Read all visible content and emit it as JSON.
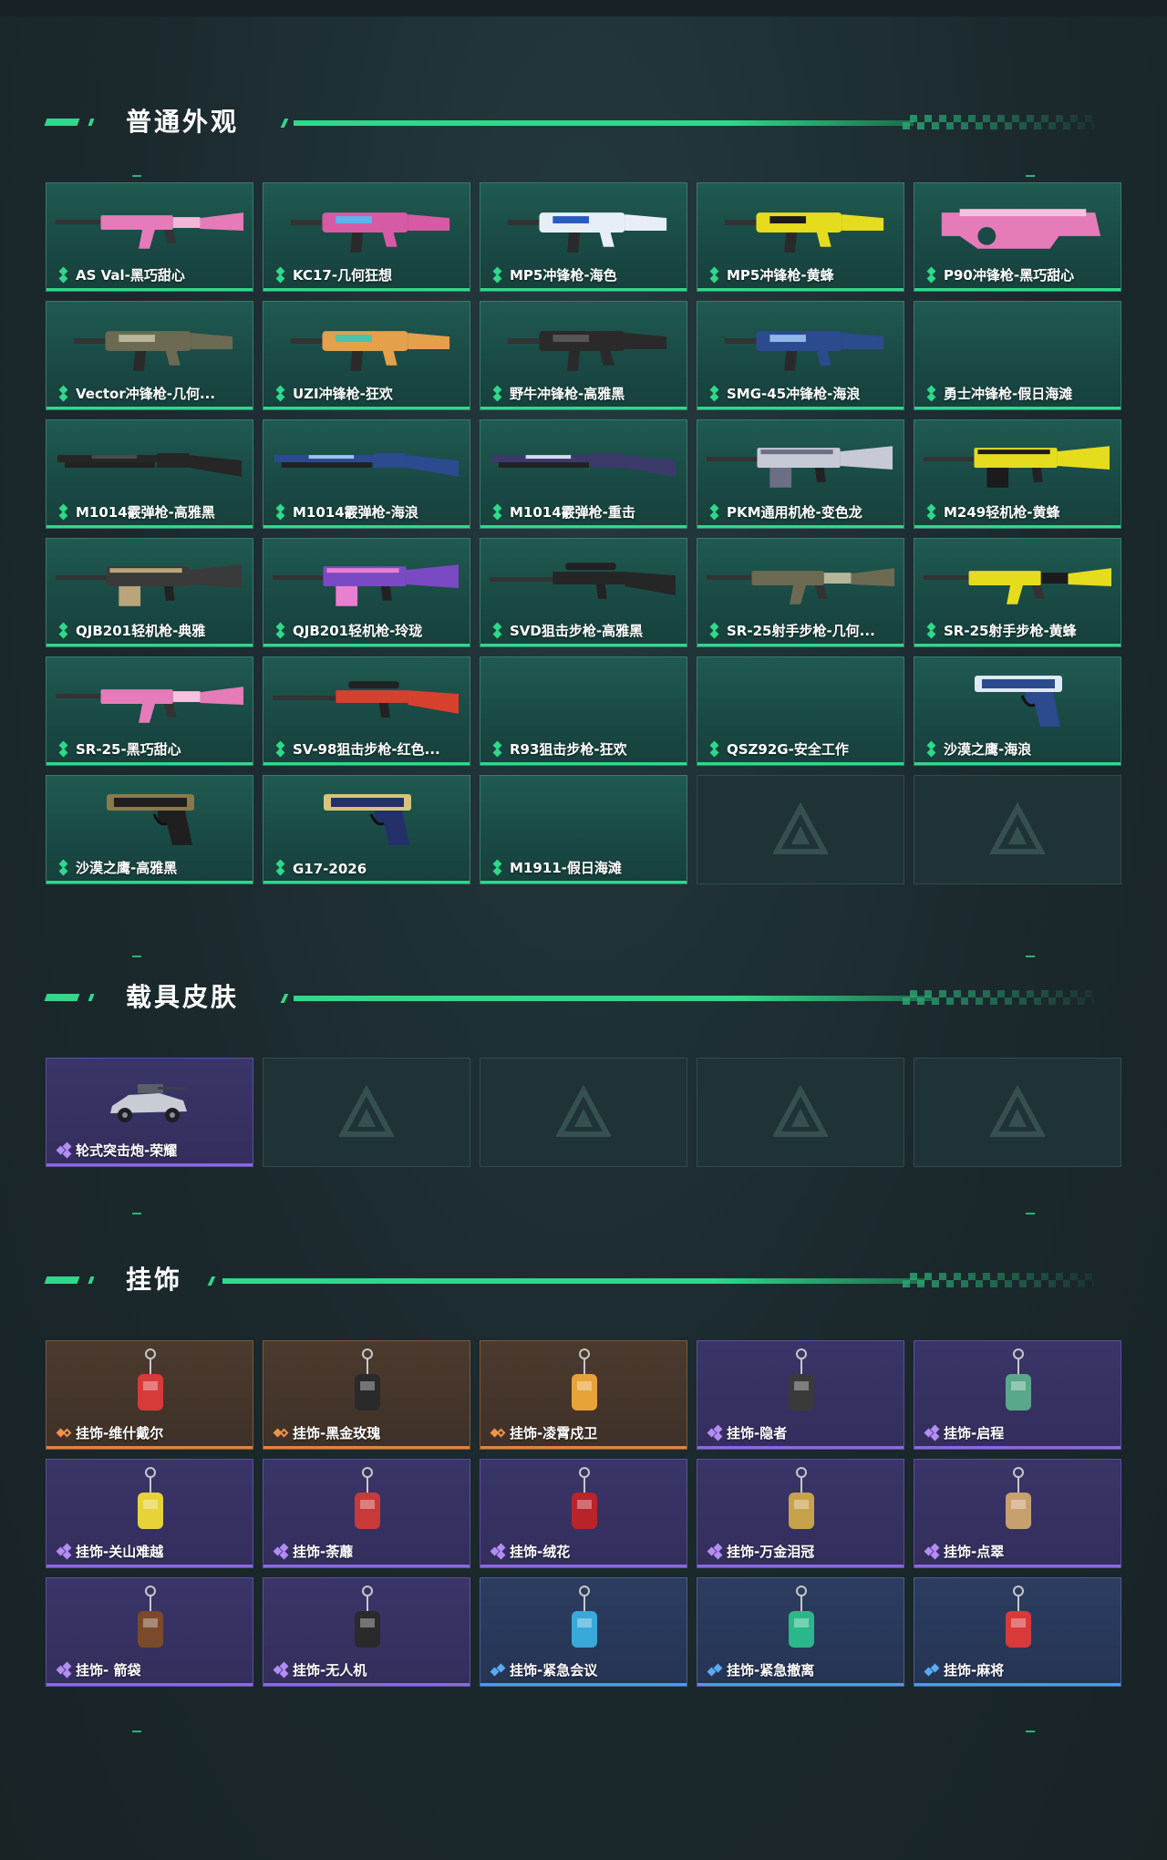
{
  "sections": {
    "normal": {
      "title": "普通外观"
    },
    "vehicle": {
      "title": "载具皮肤"
    },
    "charms": {
      "title": "挂饰"
    }
  },
  "rarity_colors": {
    "green": "#2fd88a",
    "purple": "#8c68e0",
    "orange": "#e5823a",
    "blue": "#4d9bf0"
  },
  "normal_items": [
    {
      "label": "AS Val-黑巧甜心",
      "color": "#e57bb8",
      "accent": "#f4b6d8",
      "icon": "rifle"
    },
    {
      "label": "KC17-几何狂想",
      "color": "#d75aa5",
      "accent": "#5ab4f0",
      "icon": "smg"
    },
    {
      "label": "MP5冲锋枪-海色",
      "color": "#e8eef5",
      "accent": "#2a5cc0",
      "icon": "smg"
    },
    {
      "label": "MP5冲锋枪-黄蜂",
      "color": "#e6dc1e",
      "accent": "#1b1b1b",
      "icon": "smg"
    },
    {
      "label": "P90冲锋枪-黑巧甜心",
      "color": "#e57bb8",
      "accent": "#f4c2dc",
      "icon": "p90"
    },
    {
      "label": "Vector冲锋枪-几何...",
      "color": "#6c6a52",
      "accent": "#b7b59a",
      "icon": "smg"
    },
    {
      "label": "UZI冲锋枪-狂欢",
      "color": "#e4a04a",
      "accent": "#46c6a8",
      "icon": "smg"
    },
    {
      "label": "野牛冲锋枪-高雅黑",
      "color": "#2a2a2a",
      "accent": "#555555",
      "icon": "smg"
    },
    {
      "label": "SMG-45冲锋枪-海浪",
      "color": "#2c4a8e",
      "accent": "#8fb7e8",
      "icon": "smg"
    },
    {
      "label": "勇士冲锋枪-假日海滩",
      "color": "",
      "accent": "",
      "icon": "none"
    },
    {
      "label": "M1014霰弹枪-高雅黑",
      "color": "#262626",
      "accent": "#4a4a4a",
      "icon": "shotgun"
    },
    {
      "label": "M1014霰弹枪-海浪",
      "color": "#2c4a8e",
      "accent": "#9cc3ee",
      "icon": "shotgun"
    },
    {
      "label": "M1014霰弹枪-重击",
      "color": "#3b3a6a",
      "accent": "#d8d8f0",
      "icon": "shotgun"
    },
    {
      "label": "PKM通用机枪-变色龙",
      "color": "#c7c9d6",
      "accent": "#6c6e85",
      "icon": "lmg"
    },
    {
      "label": "M249轻机枪-黄蜂",
      "color": "#e6dc1e",
      "accent": "#1b1b1b",
      "icon": "lmg"
    },
    {
      "label": "QJB201轻机枪-典雅",
      "color": "#3a3a3a",
      "accent": "#b8a57a",
      "icon": "lmg"
    },
    {
      "label": "QJB201轻机枪-玲珑",
      "color": "#7a4ac4",
      "accent": "#e87fd0",
      "icon": "lmg"
    },
    {
      "label": "SVD狙击步枪-高雅黑",
      "color": "#262626",
      "accent": "#4a4a4a",
      "icon": "sniper"
    },
    {
      "label": "SR-25射手步枪-几何...",
      "color": "#6c6a52",
      "accent": "#b7b59a",
      "icon": "rifle"
    },
    {
      "label": "SR-25射手步枪-黄蜂",
      "color": "#e6dc1e",
      "accent": "#1b1b1b",
      "icon": "rifle"
    },
    {
      "label": "SR-25-黑巧甜心",
      "color": "#e57bb8",
      "accent": "#f4c2dc",
      "icon": "rifle"
    },
    {
      "label": "SV-98狙击步枪-红色...",
      "color": "#d8402e",
      "accent": "#2a2a2a",
      "icon": "sniper"
    },
    {
      "label": "R93狙击步枪-狂欢",
      "color": "",
      "accent": "",
      "icon": "none"
    },
    {
      "label": "QSZ92G-安全工作",
      "color": "",
      "accent": "",
      "icon": "none"
    },
    {
      "label": "沙漠之鹰-海浪",
      "color": "#2c4a8e",
      "accent": "#dfe8f5",
      "icon": "pistol"
    },
    {
      "label": "沙漠之鹰-高雅黑",
      "color": "#1f1f1f",
      "accent": "#8a7a4a",
      "icon": "pistol"
    },
    {
      "label": "G17-2026",
      "color": "#23306a",
      "accent": "#d7c47a",
      "icon": "pistol"
    },
    {
      "label": "M1911-假日海滩",
      "color": "",
      "accent": "",
      "icon": "none"
    }
  ],
  "vehicle_items": [
    {
      "label": "轮式突击炮-荣耀",
      "icon": "vehicle-icon"
    }
  ],
  "charm_items": [
    {
      "label": "挂饰-维什戴尔",
      "rarity": "orange",
      "color": "#d83a3a"
    },
    {
      "label": "挂饰-黑金玫瑰",
      "rarity": "orange",
      "color": "#2a2a2a"
    },
    {
      "label": "挂饰-凌霄戍卫",
      "rarity": "orange",
      "color": "#e8a23a"
    },
    {
      "label": "挂饰-隐者",
      "rarity": "purple",
      "color": "#3a3a3a"
    },
    {
      "label": "挂饰-启程",
      "rarity": "purple",
      "color": "#5aa88a"
    },
    {
      "label": "挂饰-关山难越",
      "rarity": "purple",
      "color": "#e8d23a"
    },
    {
      "label": "挂饰-荼蘼",
      "rarity": "purple",
      "color": "#c83a3a"
    },
    {
      "label": "挂饰-绒花",
      "rarity": "purple",
      "color": "#b8242a"
    },
    {
      "label": "挂饰-万金泪冠",
      "rarity": "purple",
      "color": "#c8a24a"
    },
    {
      "label": "挂饰-点翠",
      "rarity": "purple",
      "color": "#c8a070"
    },
    {
      "label": "挂饰- 箭袋",
      "rarity": "purple",
      "color": "#7a4a2a"
    },
    {
      "label": "挂饰-无人机",
      "rarity": "purple",
      "color": "#2a2a2a"
    },
    {
      "label": "挂饰-紧急会议",
      "rarity": "blue",
      "color": "#3aa8d8"
    },
    {
      "label": "挂饰-紧急撤离",
      "rarity": "blue",
      "color": "#2ab88a"
    },
    {
      "label": "挂饰-麻将",
      "rarity": "blue",
      "color": "#d83a3a"
    }
  ]
}
